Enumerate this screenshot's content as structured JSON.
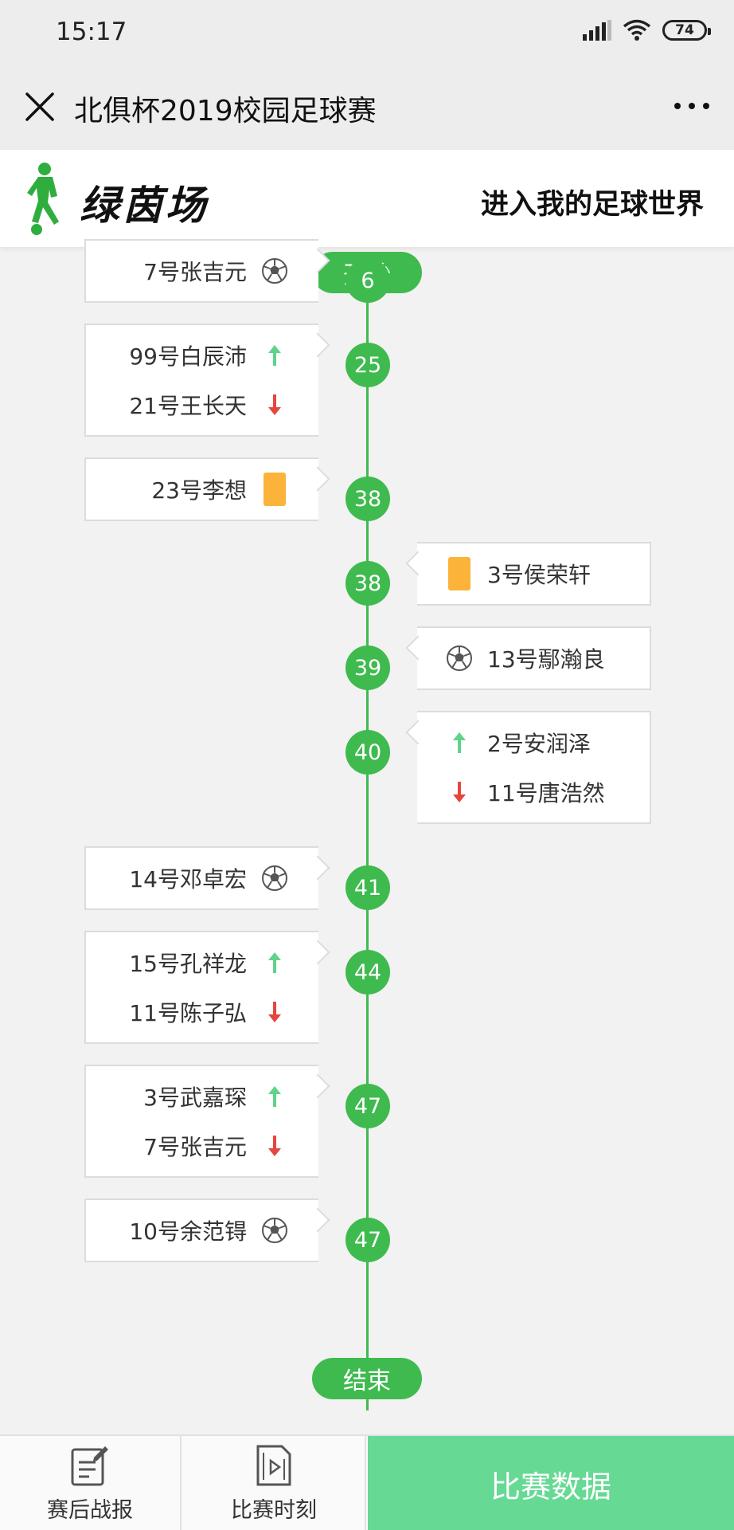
{
  "status_bar": {
    "time": "15:17",
    "battery": "74"
  },
  "title_bar": {
    "title": "北俱杯2019校园足球赛"
  },
  "brand": {
    "name": "绿茵场",
    "slogan": "进入我的足球世界"
  },
  "timeline": {
    "start_label": "开始",
    "end_label": "结束",
    "minutes": [
      "6",
      "25",
      "38",
      "38",
      "39",
      "40",
      "41",
      "44",
      "47",
      "47"
    ],
    "events": [
      {
        "side": "left",
        "items": [
          {
            "text": "7号张吉元",
            "icon": "soccer-ball-icon"
          }
        ]
      },
      {
        "side": "left",
        "items": [
          {
            "text": "99号白辰沛",
            "icon": "sub-in-arrow-icon"
          },
          {
            "text": "21号王长天",
            "icon": "sub-out-arrow-icon"
          }
        ]
      },
      {
        "side": "left",
        "items": [
          {
            "text": "23号李想",
            "icon": "yellow-card-icon"
          }
        ]
      },
      {
        "side": "right",
        "items": [
          {
            "text": "3号侯荣轩",
            "icon": "yellow-card-icon"
          }
        ]
      },
      {
        "side": "right",
        "items": [
          {
            "text": "13号鄢瀚良",
            "icon": "soccer-ball-icon"
          }
        ]
      },
      {
        "side": "right",
        "items": [
          {
            "text": "2号安润泽",
            "icon": "sub-in-arrow-icon"
          },
          {
            "text": "11号唐浩然",
            "icon": "sub-out-arrow-icon"
          }
        ]
      },
      {
        "side": "left",
        "items": [
          {
            "text": "14号邓卓宏",
            "icon": "soccer-ball-icon"
          }
        ]
      },
      {
        "side": "left",
        "items": [
          {
            "text": "15号孔祥龙",
            "icon": "sub-in-arrow-icon"
          },
          {
            "text": "11号陈子弘",
            "icon": "sub-out-arrow-icon"
          }
        ]
      },
      {
        "side": "left",
        "items": [
          {
            "text": "3号武嘉琛",
            "icon": "sub-in-arrow-icon"
          },
          {
            "text": "7号张吉元",
            "icon": "sub-out-arrow-icon"
          }
        ]
      },
      {
        "side": "left",
        "items": [
          {
            "text": "10号余范锝",
            "icon": "soccer-ball-icon"
          }
        ]
      }
    ]
  },
  "bottom_nav": {
    "report_label": "赛后战报",
    "moments_label": "比赛时刻",
    "data_label": "比赛数据"
  },
  "colors": {
    "accent_green": "#3fba4f",
    "data_button": "#66d994",
    "yellow_card": "#fbb33a",
    "sub_in": "#5fd38a",
    "sub_out": "#e5463e"
  }
}
